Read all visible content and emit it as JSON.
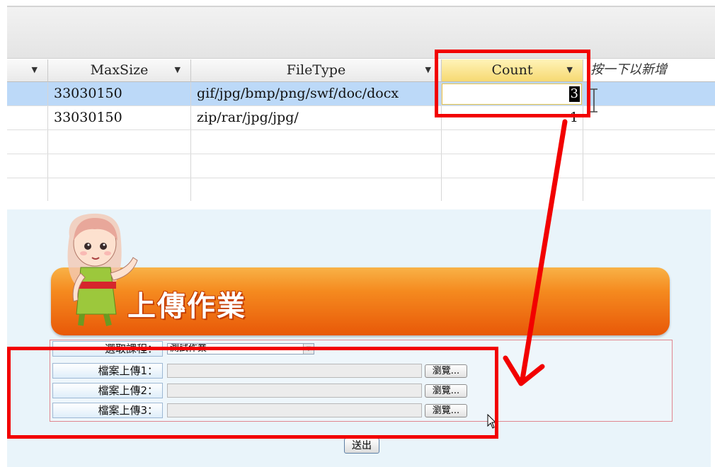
{
  "grid": {
    "headers": [
      "MaxSize",
      "FileType",
      "Count",
      "按一下以新增"
    ],
    "rows": [
      {
        "max_size": "33030150",
        "file_type": "gif/jpg/bmp/png/swf/doc/docx",
        "count": "3"
      },
      {
        "max_size": "33030150",
        "file_type": "zip/rar/jpg/jpg/",
        "count": "1"
      }
    ]
  },
  "upload": {
    "title": "上傳作業",
    "course_label": "選取課程：",
    "course_value": "測試作業",
    "file_labels": [
      "檔案上傳1：",
      "檔案上傳2：",
      "檔案上傳3："
    ],
    "browse_label": "瀏覽...",
    "submit_label": "送出"
  },
  "colors": {
    "annotation": "#f20000",
    "selected_row": "#bcd9f8",
    "banner": "#f07a14",
    "panel": "#e9f4fa"
  }
}
